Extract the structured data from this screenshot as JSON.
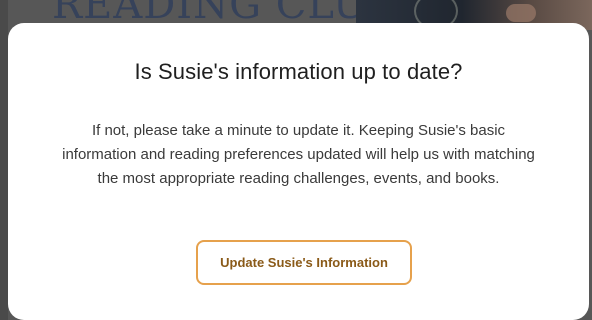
{
  "background": {
    "heading": "READING CLUB"
  },
  "modal": {
    "title": "Is Susie's information up to date?",
    "body": "If not, please take a minute to update it. Keeping Susie's basic information and reading preferences updated will help us with matching the most appropriate reading challenges, events, and books.",
    "button_label": "Update Susie's Information"
  },
  "colors": {
    "overlay": "#575757",
    "modal_background": "#ffffff",
    "button_border": "#e6a14c",
    "button_text": "#8a5a18",
    "title_text": "#1f1f1f"
  }
}
